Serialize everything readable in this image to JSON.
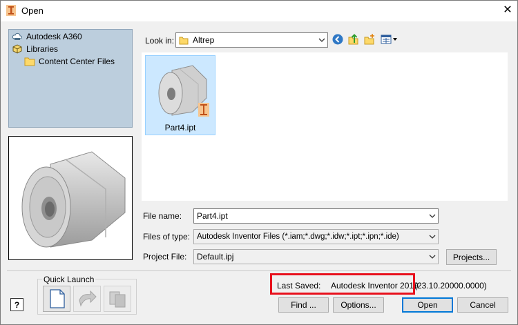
{
  "window": {
    "title": "Open",
    "close_glyph": "✕"
  },
  "nav": {
    "items": [
      {
        "label": "Autodesk A360",
        "icon": "cloud-drive-icon"
      },
      {
        "label": "Libraries",
        "icon": "libraries-icon"
      },
      {
        "label": "Content Center Files",
        "icon": "folder-icon"
      }
    ]
  },
  "look_in": {
    "label": "Look in:",
    "value": "Altrep"
  },
  "toolbar": {
    "back_icon": "back-icon",
    "up_icon": "up-folder-icon",
    "new_folder_icon": "new-folder-icon",
    "views_icon": "views-menu-icon"
  },
  "files": [
    {
      "name": "Part4.ipt",
      "selected": true
    }
  ],
  "fields": {
    "file_name": {
      "label": "File name:",
      "value": "Part4.ipt"
    },
    "files_of_type": {
      "label": "Files of type:",
      "value": "Autodesk Inventor Files (*.iam;*.dwg;*.idw;*.ipt;*.ipn;*.ide)"
    },
    "project_file": {
      "label": "Project File:",
      "value": "Default.ipj"
    }
  },
  "buttons": {
    "projects": "Projects...",
    "find": "Find ...",
    "options": "Options...",
    "open": "Open",
    "cancel": "Cancel",
    "help": "?"
  },
  "quick_launch": {
    "label": "Quick Launch"
  },
  "last_saved": {
    "label": "Last Saved:",
    "app": "Autodesk Inventor 2019",
    "version": "(23.10.20000.0000)"
  },
  "colors": {
    "accent": "#0078d7",
    "highlight": "#e8101c",
    "nav_bg": "#bccedd",
    "selection": "#cce8ff"
  }
}
